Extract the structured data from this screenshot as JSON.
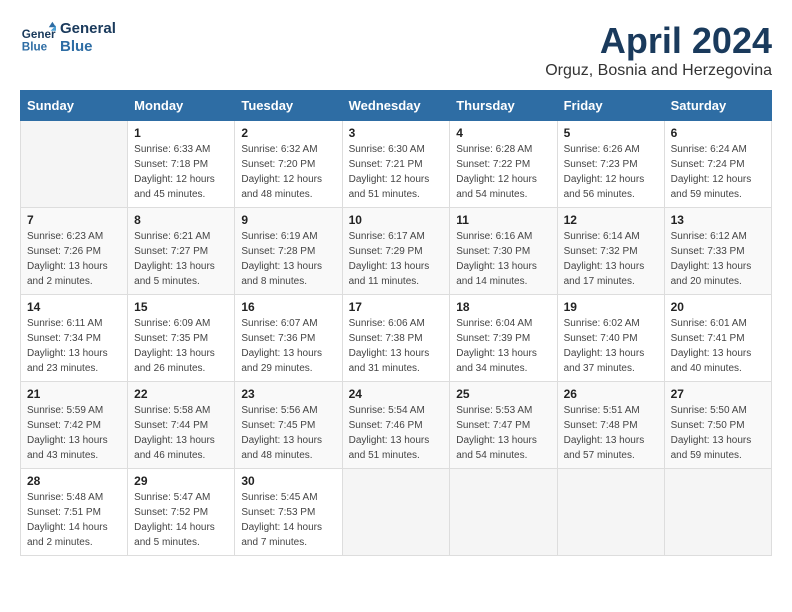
{
  "logo": {
    "line1": "General",
    "line2": "Blue"
  },
  "title": "April 2024",
  "subtitle": "Orguz, Bosnia and Herzegovina",
  "weekdays": [
    "Sunday",
    "Monday",
    "Tuesday",
    "Wednesday",
    "Thursday",
    "Friday",
    "Saturday"
  ],
  "weeks": [
    [
      {
        "day": "",
        "info": ""
      },
      {
        "day": "1",
        "info": "Sunrise: 6:33 AM\nSunset: 7:18 PM\nDaylight: 12 hours\nand 45 minutes."
      },
      {
        "day": "2",
        "info": "Sunrise: 6:32 AM\nSunset: 7:20 PM\nDaylight: 12 hours\nand 48 minutes."
      },
      {
        "day": "3",
        "info": "Sunrise: 6:30 AM\nSunset: 7:21 PM\nDaylight: 12 hours\nand 51 minutes."
      },
      {
        "day": "4",
        "info": "Sunrise: 6:28 AM\nSunset: 7:22 PM\nDaylight: 12 hours\nand 54 minutes."
      },
      {
        "day": "5",
        "info": "Sunrise: 6:26 AM\nSunset: 7:23 PM\nDaylight: 12 hours\nand 56 minutes."
      },
      {
        "day": "6",
        "info": "Sunrise: 6:24 AM\nSunset: 7:24 PM\nDaylight: 12 hours\nand 59 minutes."
      }
    ],
    [
      {
        "day": "7",
        "info": "Sunrise: 6:23 AM\nSunset: 7:26 PM\nDaylight: 13 hours\nand 2 minutes."
      },
      {
        "day": "8",
        "info": "Sunrise: 6:21 AM\nSunset: 7:27 PM\nDaylight: 13 hours\nand 5 minutes."
      },
      {
        "day": "9",
        "info": "Sunrise: 6:19 AM\nSunset: 7:28 PM\nDaylight: 13 hours\nand 8 minutes."
      },
      {
        "day": "10",
        "info": "Sunrise: 6:17 AM\nSunset: 7:29 PM\nDaylight: 13 hours\nand 11 minutes."
      },
      {
        "day": "11",
        "info": "Sunrise: 6:16 AM\nSunset: 7:30 PM\nDaylight: 13 hours\nand 14 minutes."
      },
      {
        "day": "12",
        "info": "Sunrise: 6:14 AM\nSunset: 7:32 PM\nDaylight: 13 hours\nand 17 minutes."
      },
      {
        "day": "13",
        "info": "Sunrise: 6:12 AM\nSunset: 7:33 PM\nDaylight: 13 hours\nand 20 minutes."
      }
    ],
    [
      {
        "day": "14",
        "info": "Sunrise: 6:11 AM\nSunset: 7:34 PM\nDaylight: 13 hours\nand 23 minutes."
      },
      {
        "day": "15",
        "info": "Sunrise: 6:09 AM\nSunset: 7:35 PM\nDaylight: 13 hours\nand 26 minutes."
      },
      {
        "day": "16",
        "info": "Sunrise: 6:07 AM\nSunset: 7:36 PM\nDaylight: 13 hours\nand 29 minutes."
      },
      {
        "day": "17",
        "info": "Sunrise: 6:06 AM\nSunset: 7:38 PM\nDaylight: 13 hours\nand 31 minutes."
      },
      {
        "day": "18",
        "info": "Sunrise: 6:04 AM\nSunset: 7:39 PM\nDaylight: 13 hours\nand 34 minutes."
      },
      {
        "day": "19",
        "info": "Sunrise: 6:02 AM\nSunset: 7:40 PM\nDaylight: 13 hours\nand 37 minutes."
      },
      {
        "day": "20",
        "info": "Sunrise: 6:01 AM\nSunset: 7:41 PM\nDaylight: 13 hours\nand 40 minutes."
      }
    ],
    [
      {
        "day": "21",
        "info": "Sunrise: 5:59 AM\nSunset: 7:42 PM\nDaylight: 13 hours\nand 43 minutes."
      },
      {
        "day": "22",
        "info": "Sunrise: 5:58 AM\nSunset: 7:44 PM\nDaylight: 13 hours\nand 46 minutes."
      },
      {
        "day": "23",
        "info": "Sunrise: 5:56 AM\nSunset: 7:45 PM\nDaylight: 13 hours\nand 48 minutes."
      },
      {
        "day": "24",
        "info": "Sunrise: 5:54 AM\nSunset: 7:46 PM\nDaylight: 13 hours\nand 51 minutes."
      },
      {
        "day": "25",
        "info": "Sunrise: 5:53 AM\nSunset: 7:47 PM\nDaylight: 13 hours\nand 54 minutes."
      },
      {
        "day": "26",
        "info": "Sunrise: 5:51 AM\nSunset: 7:48 PM\nDaylight: 13 hours\nand 57 minutes."
      },
      {
        "day": "27",
        "info": "Sunrise: 5:50 AM\nSunset: 7:50 PM\nDaylight: 13 hours\nand 59 minutes."
      }
    ],
    [
      {
        "day": "28",
        "info": "Sunrise: 5:48 AM\nSunset: 7:51 PM\nDaylight: 14 hours\nand 2 minutes."
      },
      {
        "day": "29",
        "info": "Sunrise: 5:47 AM\nSunset: 7:52 PM\nDaylight: 14 hours\nand 5 minutes."
      },
      {
        "day": "30",
        "info": "Sunrise: 5:45 AM\nSunset: 7:53 PM\nDaylight: 14 hours\nand 7 minutes."
      },
      {
        "day": "",
        "info": ""
      },
      {
        "day": "",
        "info": ""
      },
      {
        "day": "",
        "info": ""
      },
      {
        "day": "",
        "info": ""
      }
    ]
  ]
}
